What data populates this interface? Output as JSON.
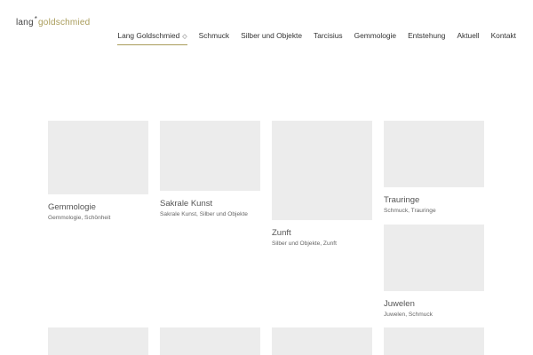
{
  "logo": {
    "part1": "lang",
    "star": "*",
    "part2": "goldschmied"
  },
  "nav": [
    {
      "label": "Lang Goldschmied",
      "active": true
    },
    {
      "label": "Schmuck"
    },
    {
      "label": "Silber und Objekte"
    },
    {
      "label": "Tarcisius"
    },
    {
      "label": "Gemmologie"
    },
    {
      "label": "Entstehung"
    },
    {
      "label": "Aktuell"
    },
    {
      "label": "Kontakt"
    }
  ],
  "nav_dropdown_glyph": "◇",
  "colors": {
    "accent": "#a99c5a",
    "thumb": "#ececec"
  },
  "cards": [
    {
      "title": "Gemmologie",
      "tags": "Gemmologie, Schönheit"
    },
    {
      "title": "Sakrale Kunst",
      "tags": "Sakrale Kunst, Silber und Objekte"
    },
    {
      "title": "Zunft",
      "tags": "Silber und Objekte, Zunft"
    },
    {
      "title": "Trauringe",
      "tags": "Schmuck, Trauringe"
    },
    {
      "title": "Juwelen",
      "tags": "Juwelen, Schmuck"
    },
    {
      "title": "",
      "tags": ""
    },
    {
      "title": "",
      "tags": ""
    },
    {
      "title": "",
      "tags": ""
    },
    {
      "title": "",
      "tags": ""
    }
  ]
}
